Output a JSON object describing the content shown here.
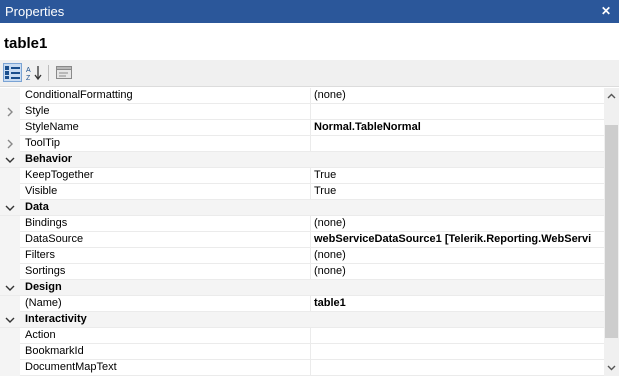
{
  "window": {
    "title": "Properties",
    "close_glyph": "✕"
  },
  "object_name": "table1",
  "toolbar": {
    "buttons": [
      {
        "name": "categorized-icon",
        "active": true
      },
      {
        "name": "alphabetical-sort-icon",
        "active": false
      },
      {
        "name": "property-pages-icon",
        "active": false
      }
    ]
  },
  "grid": {
    "rows": [
      {
        "type": "prop",
        "name": "ConditionalFormatting",
        "value": "(none)"
      },
      {
        "type": "prop",
        "name": "Style",
        "value": "",
        "expander": "collapsed"
      },
      {
        "type": "prop",
        "name": "StyleName",
        "value": "Normal.TableNormal",
        "bold": true
      },
      {
        "type": "prop",
        "name": "ToolTip",
        "value": "",
        "expander": "collapsed"
      },
      {
        "type": "cat",
        "name": "Behavior"
      },
      {
        "type": "prop",
        "name": "KeepTogether",
        "value": "True"
      },
      {
        "type": "prop",
        "name": "Visible",
        "value": "True"
      },
      {
        "type": "cat",
        "name": "Data"
      },
      {
        "type": "prop",
        "name": "Bindings",
        "value": "(none)"
      },
      {
        "type": "prop",
        "name": "DataSource",
        "value": "webServiceDataSource1 [Telerik.Reporting.WebServi",
        "bold": true
      },
      {
        "type": "prop",
        "name": "Filters",
        "value": "(none)"
      },
      {
        "type": "prop",
        "name": "Sortings",
        "value": "(none)"
      },
      {
        "type": "cat",
        "name": "Design"
      },
      {
        "type": "prop",
        "name": "(Name)",
        "value": "table1",
        "bold": true
      },
      {
        "type": "cat",
        "name": "Interactivity"
      },
      {
        "type": "prop",
        "name": "Action",
        "value": ""
      },
      {
        "type": "prop",
        "name": "BookmarkId",
        "value": ""
      },
      {
        "type": "prop",
        "name": "DocumentMapText",
        "value": ""
      }
    ]
  },
  "colors": {
    "titlebar": "#2b579a",
    "category_band": "#f4f4f4"
  }
}
